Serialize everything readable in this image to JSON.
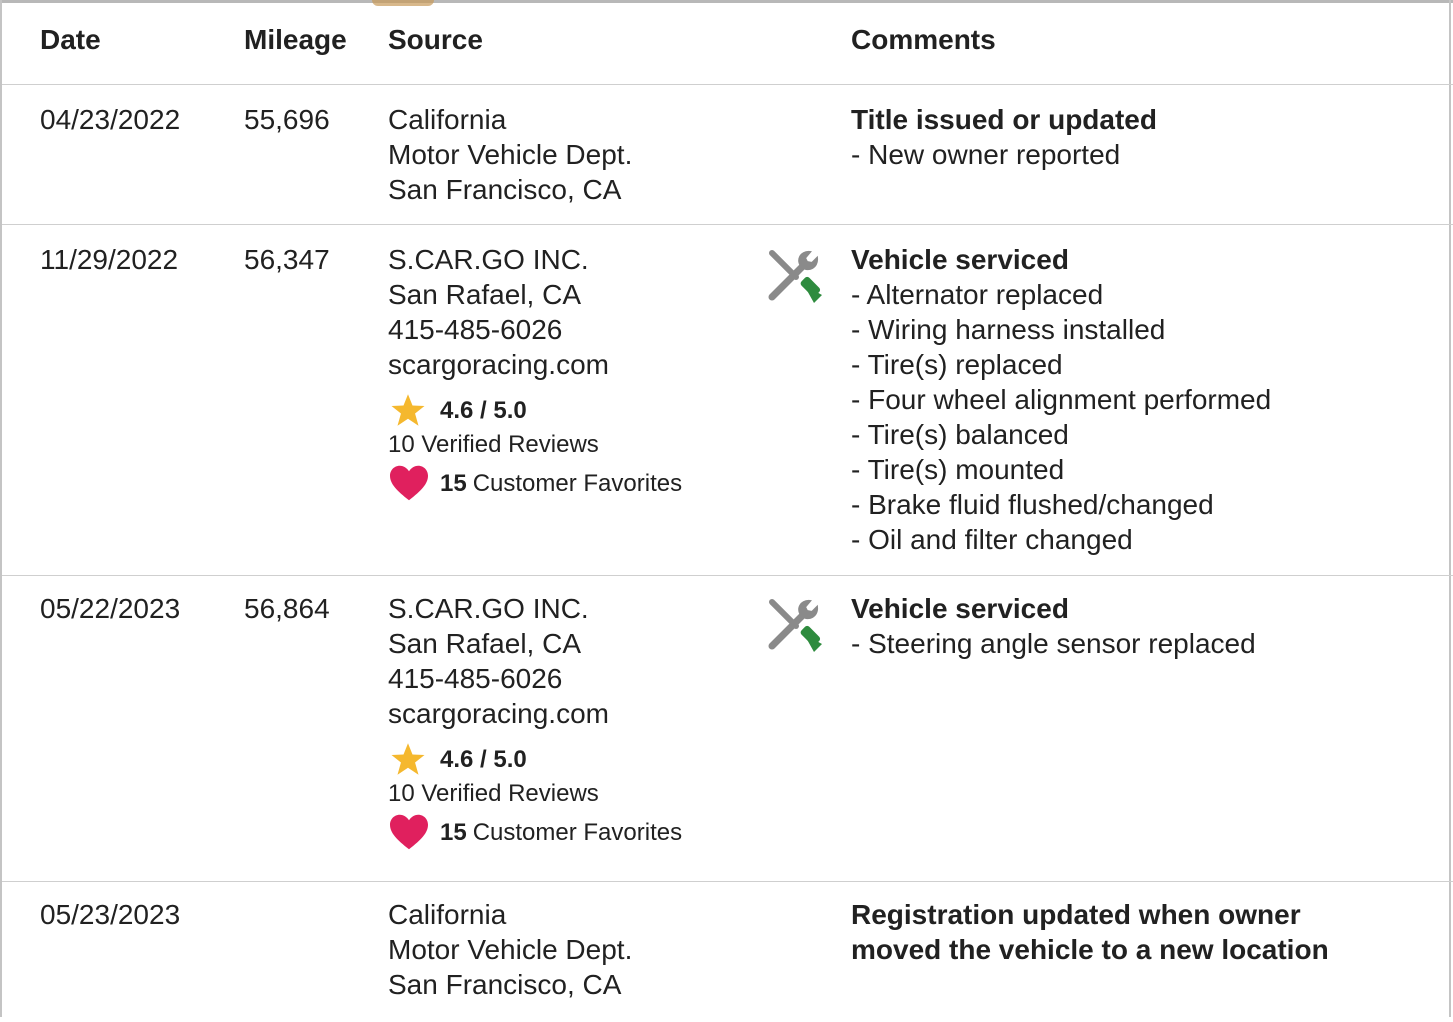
{
  "columns": {
    "date": "Date",
    "mileage": "Mileage",
    "source": "Source",
    "comments": "Comments"
  },
  "records": [
    {
      "date": "04/23/2022",
      "mileage": "55,696",
      "source_lines": [
        "California",
        "Motor Vehicle Dept.",
        "San Francisco, CA"
      ],
      "comment_title": "Title issued or updated",
      "comment_items": [
        "- New owner reported"
      ]
    },
    {
      "date": "11/29/2022",
      "mileage": "56,347",
      "source_lines": [
        "S.CAR.GO INC.",
        "San Rafael, CA",
        "415-485-6026",
        "scargoracing.com"
      ],
      "rating": "4.6 / 5.0",
      "reviews": "10 Verified Reviews",
      "favorites_count": "15",
      "favorites_label": "Customer Favorites",
      "icon": "wrench-screwdriver-icon",
      "comment_title": "Vehicle serviced",
      "comment_items": [
        "- Alternator replaced",
        "- Wiring harness installed",
        "- Tire(s) replaced",
        "- Four wheel alignment performed",
        "- Tire(s) balanced",
        "- Tire(s) mounted",
        "- Brake fluid flushed/changed",
        "- Oil and filter changed"
      ]
    },
    {
      "date": "05/22/2023",
      "mileage": "56,864",
      "source_lines": [
        "S.CAR.GO INC.",
        "San Rafael, CA",
        "415-485-6026",
        "scargoracing.com"
      ],
      "rating": "4.6 / 5.0",
      "reviews": "10 Verified Reviews",
      "favorites_count": "15",
      "favorites_label": "Customer Favorites",
      "icon": "wrench-screwdriver-icon",
      "comment_title": "Vehicle serviced",
      "comment_items": [
        "- Steering angle sensor replaced"
      ]
    },
    {
      "date": "05/23/2023",
      "mileage": "",
      "source_lines": [
        "California",
        "Motor Vehicle Dept.",
        "San Francisco, CA"
      ],
      "comment_title_lines": [
        "Registration updated when owner",
        "moved the vehicle to a new location"
      ]
    }
  ],
  "colors": {
    "star": "#f5b82e",
    "heart": "#e0205e",
    "screwdriver_handle": "#2e8b3e",
    "tool_gray": "#8a8a8a",
    "divider": "#cfcfcf"
  }
}
